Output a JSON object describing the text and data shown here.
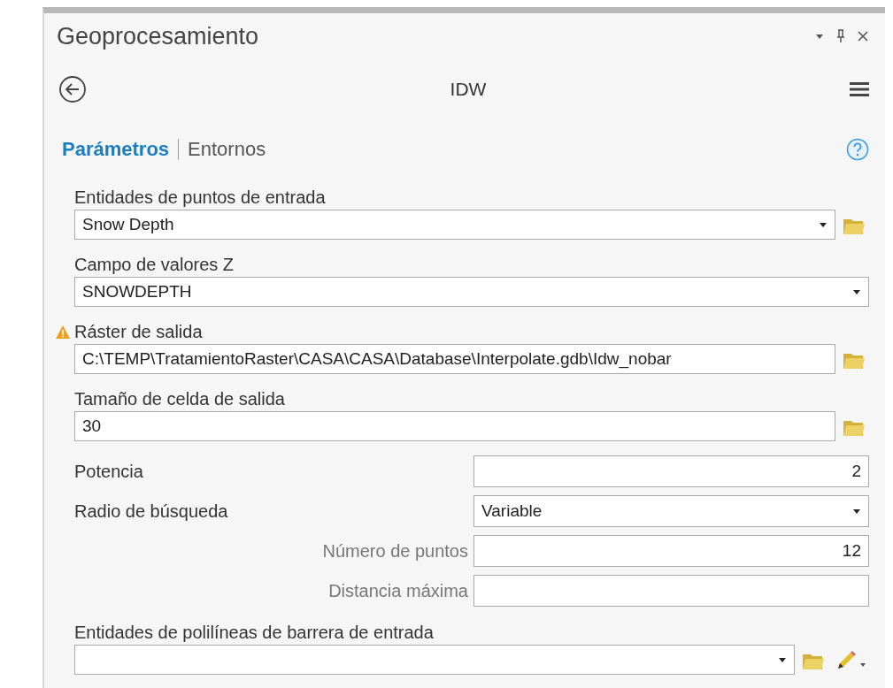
{
  "window": {
    "title": "Geoprocesamiento"
  },
  "tool": {
    "title": "IDW"
  },
  "tabs": [
    {
      "label": "Parámetros",
      "selected": true
    },
    {
      "label": "Entornos",
      "selected": false
    }
  ],
  "params": [
    {
      "kind": "stacked",
      "label": "Entidades de puntos de entrada",
      "value": "Snow Depth",
      "dropdown": true,
      "browse": true,
      "warning": false,
      "sketch": false
    },
    {
      "kind": "stacked",
      "label": "Campo de valores Z",
      "value": "SNOWDEPTH",
      "dropdown": true,
      "browse": false,
      "warning": false,
      "sketch": false
    },
    {
      "kind": "stacked",
      "label": "Ráster de salida",
      "value": "C:\\TEMP\\TratamientoRaster\\CASA\\CASA\\Database\\Interpolate.gdb\\Idw_nobar",
      "dropdown": false,
      "browse": true,
      "warning": true,
      "sketch": false
    },
    {
      "kind": "stacked",
      "label": "Tamaño de celda de salida",
      "value": "30",
      "dropdown": false,
      "browse": true,
      "warning": false,
      "sketch": false
    },
    {
      "kind": "inline",
      "label": "Potencia",
      "value": "2",
      "dropdown": false,
      "browse": false,
      "warning": false,
      "sketch": false
    },
    {
      "kind": "inline",
      "label": "Radio de búsqueda",
      "value": "Variable",
      "dropdown": true,
      "browse": false,
      "warning": false,
      "sketch": false
    },
    {
      "kind": "sub",
      "label": "Número de puntos",
      "value": "12",
      "dropdown": false,
      "browse": false,
      "warning": false,
      "sketch": false
    },
    {
      "kind": "sub",
      "label": "Distancia máxima",
      "dropdown": false,
      "browse": false,
      "warning": false,
      "sketch": false
    },
    {
      "kind": "stacked",
      "label": "Entidades de polilíneas de barrera de entrada",
      "dropdown": true,
      "browse": true,
      "warning": false,
      "sketch": true
    }
  ]
}
